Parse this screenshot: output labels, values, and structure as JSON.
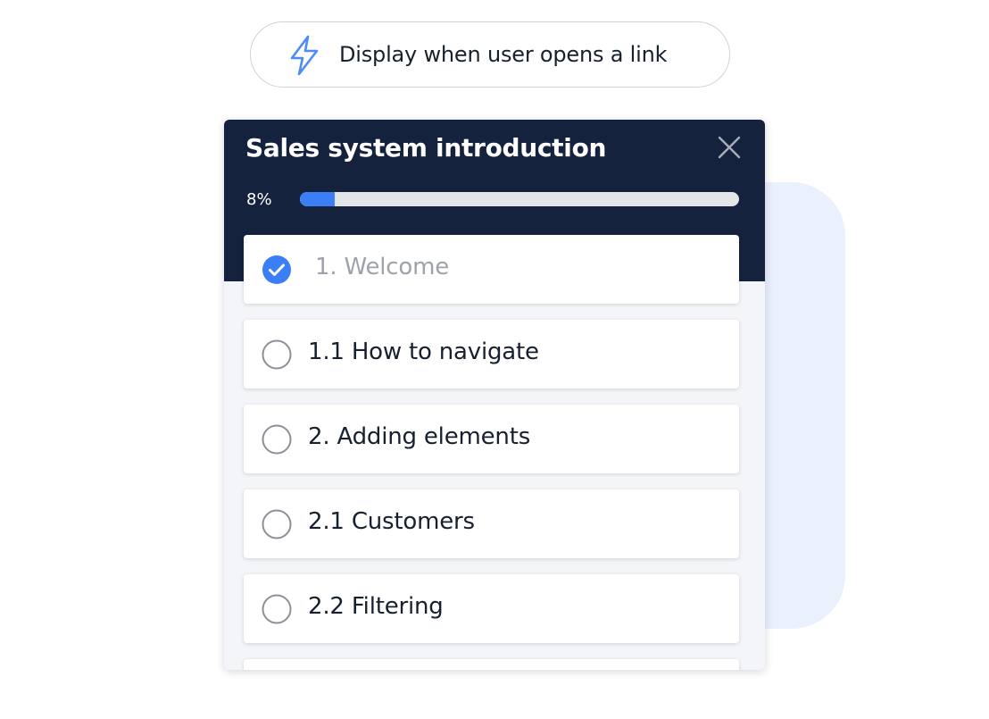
{
  "trigger": {
    "icon": "lightning-bolt-icon",
    "label": "Display when user opens a link"
  },
  "checklist": {
    "title": "Sales system introduction",
    "close_icon": "close-icon",
    "progress_text": "8%",
    "progress_fraction": 0.08,
    "accent_color": "#3c7ef5",
    "header_color": "#15223e",
    "tasks": [
      {
        "label": "1. Welcome",
        "done": true
      },
      {
        "label": "1.1 How to navigate",
        "done": false
      },
      {
        "label": "2. Adding elements",
        "done": false
      },
      {
        "label": "2.1 Customers",
        "done": false
      },
      {
        "label": "2.2 Filtering",
        "done": false
      },
      {
        "label": "",
        "done": false
      }
    ]
  }
}
